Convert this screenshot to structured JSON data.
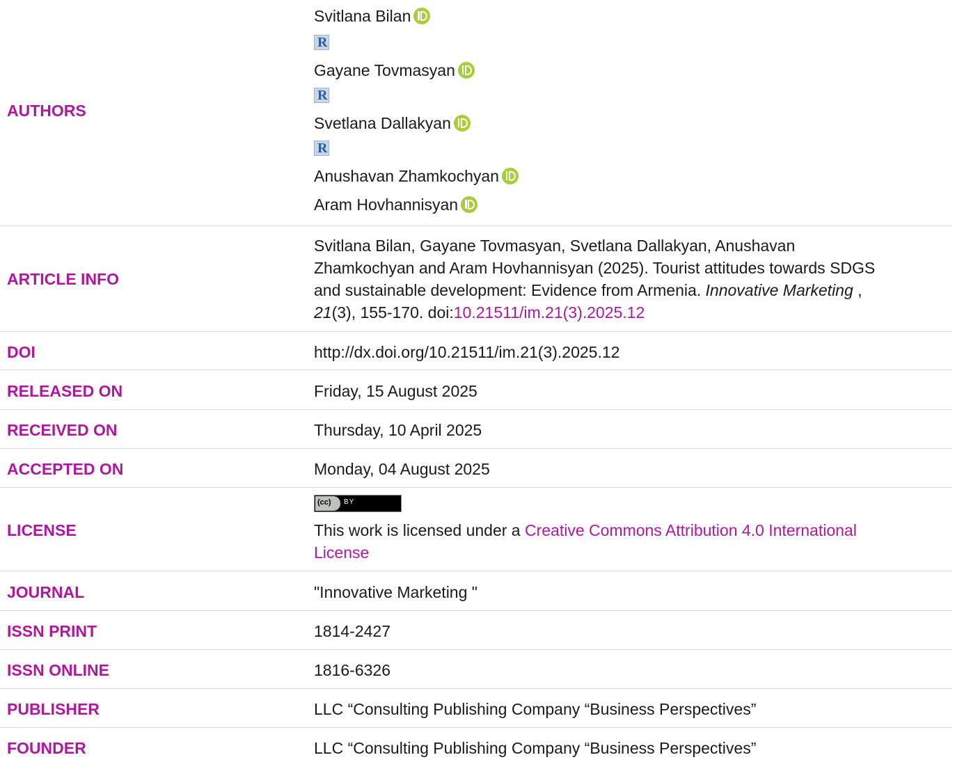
{
  "authors": {
    "label": "AUTHORS",
    "people": [
      {
        "name": "Svitlana Bilan",
        "orcid": true,
        "researchgate": true
      },
      {
        "name": "Gayane Tovmasyan",
        "orcid": true,
        "researchgate": true
      },
      {
        "name": "Svetlana Dallakyan",
        "orcid": true,
        "researchgate": true
      },
      {
        "name": "Anushavan Zhamkochyan",
        "orcid": true,
        "researchgate": false
      },
      {
        "name": "Aram Hovhannisyan",
        "orcid": true,
        "researchgate": false
      }
    ],
    "researchgate_letter": "R"
  },
  "article_info": {
    "label": "ARTICLE INFO",
    "line1": "Svitlana Bilan, Gayane Tovmasyan, Svetlana Dallakyan, Anushavan",
    "line2": "Zhamkochyan and Aram Hovhannisyan (2025). Tourist attitudes towards SDGS",
    "line3_text": "and sustainable development: Evidence from Armenia. ",
    "journal_italic": "Innovative Marketing",
    "line3_end": " ,",
    "volume_italic": "21",
    "line4_text": "(3), 155-170. doi:",
    "doi_link": "10.21511/im.21(3).2025.12"
  },
  "doi": {
    "label": "DOI",
    "value": "http://dx.doi.org/10.21511/im.21(3).2025.12"
  },
  "released": {
    "label": "RELEASED ON",
    "value": "Friday, 15 August 2025"
  },
  "received": {
    "label": "RECEIVED ON",
    "value": "Thursday, 10 April 2025"
  },
  "accepted": {
    "label": "ACCEPTED ON",
    "value": "Monday, 04 August 2025"
  },
  "license": {
    "label": "LICENSE",
    "badge_cc": "(cc)",
    "badge_by": "BY",
    "text": "This work is licensed under a ",
    "link_line1": "Creative Commons Attribution 4.0 International",
    "link_line2": "License"
  },
  "journal": {
    "label": "JOURNAL",
    "value": "\"Innovative Marketing \""
  },
  "issn_print": {
    "label": "ISSN PRINT",
    "value": "1814-2427"
  },
  "issn_online": {
    "label": "ISSN ONLINE",
    "value": "1816-6326"
  },
  "publisher": {
    "label": "PUBLISHER",
    "value": "LLC “Consulting Publishing Company “Business Perspectives”"
  },
  "founder": {
    "label": "FOUNDER",
    "value": "LLC “Consulting Publishing Company “Business Perspectives”"
  },
  "colors": {
    "label": "#b0179f",
    "link": "#b0179f",
    "orcid": "#a6ce39",
    "separator": "#d9d9d9"
  }
}
